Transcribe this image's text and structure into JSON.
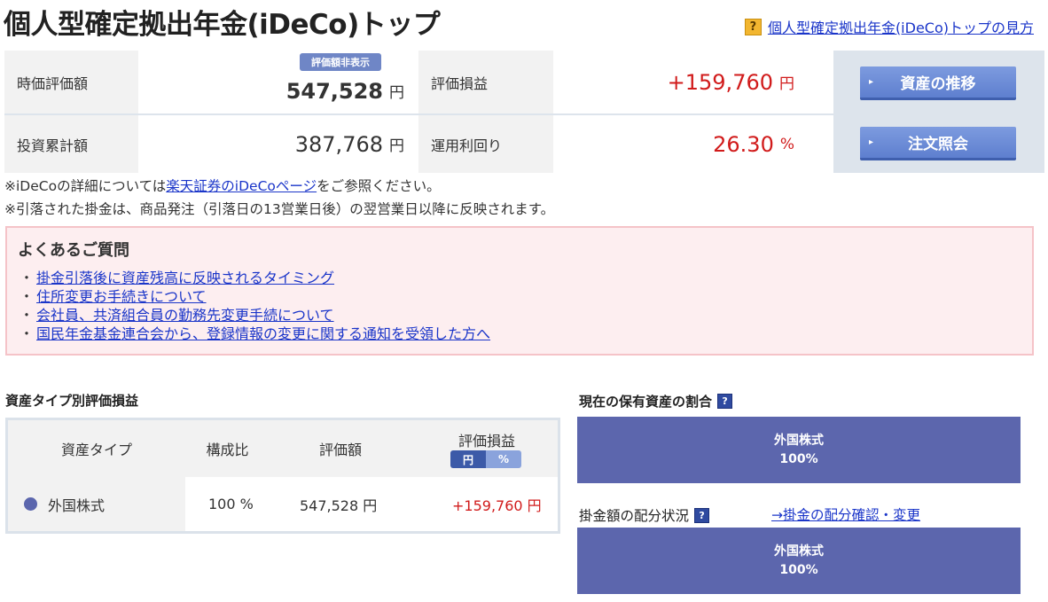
{
  "header": {
    "title": "個人型確定拠出年金(iDeCo)トップ",
    "help_icon": "?",
    "help_link": "個人型確定拠出年金(iDeCo)トップの見方"
  },
  "summary": {
    "market_value_label": "時価評価額",
    "hidden_badge": "評価額非表示",
    "market_value": "547,528",
    "unit_yen": "円",
    "gain_label": "評価損益",
    "gain_value": "+159,760",
    "invested_label": "投資累計額",
    "invested_value": "387,768",
    "yield_label": "運用利回り",
    "yield_value": "26.30",
    "unit_pct": "%",
    "btn_asset_history": "資産の推移",
    "btn_order_inquiry": "注文照会"
  },
  "notes": {
    "line1_prefix": "※iDeCoの詳細については",
    "line1_link": "楽天証券のiDeCoページ",
    "line1_suffix": "をご参照ください。",
    "line2": "※引落された掛金は、商品発注（引落日の13営業日後）の翌営業日以降に反映されます。"
  },
  "faq": {
    "title": "よくあるご質問",
    "bullet": "・",
    "items": [
      "掛金引落後に資産残高に反映されるタイミング",
      "住所変更お手続きについて",
      "会社員、共済組合員の勤務先変更手続について",
      "国民年金基金連合会から、登録情報の変更に関する通知を受領した方へ"
    ]
  },
  "asset_section": {
    "title": "資産タイプ別評価損益",
    "headers": [
      "資産タイプ",
      "構成比",
      "評価額",
      "評価損益"
    ],
    "toggle_yen": "円",
    "toggle_pct": "%",
    "rows": [
      {
        "type": "外国株式",
        "ratio": "100 %",
        "value": "547,528 円",
        "gain": "+159,760 円"
      }
    ],
    "legend_color": "#5b66ad"
  },
  "holdings": {
    "title": "現在の保有資産の割合",
    "help_icon": "?",
    "label": "外国株式",
    "pct": "100%",
    "color": "#5c66ad"
  },
  "contribution": {
    "title": "掛金額の配分状況",
    "help_icon": "?",
    "link": "→掛金の配分確認・変更",
    "label": "外国株式",
    "pct": "100%"
  },
  "colors": {
    "positive": "#d11b1b",
    "link": "#1a35c9",
    "button": "#6a8ad8"
  }
}
